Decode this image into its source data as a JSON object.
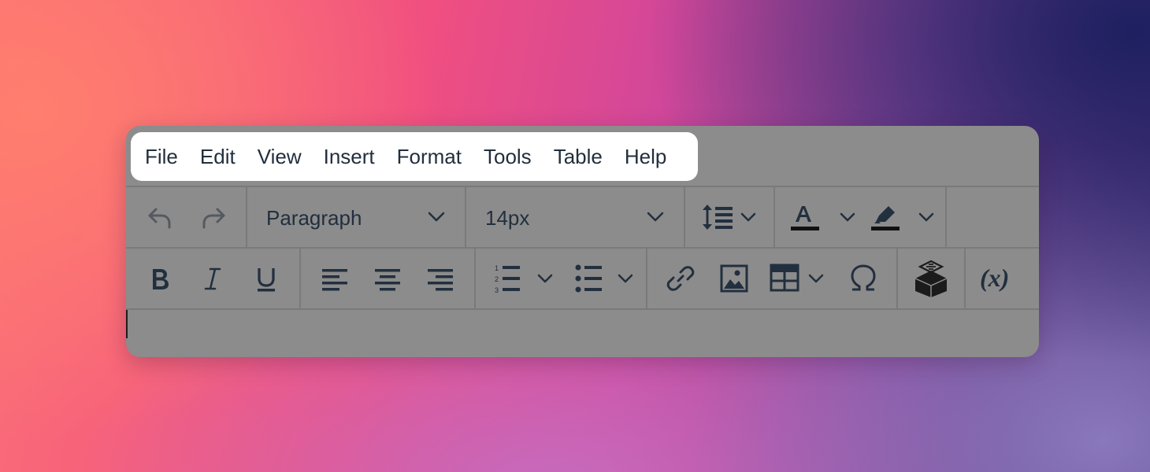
{
  "menubar": {
    "items": [
      "File",
      "Edit",
      "View",
      "Insert",
      "Format",
      "Tools",
      "Table",
      "Help"
    ]
  },
  "toolbar": {
    "block_format": "Paragraph",
    "font_size": "14px",
    "icons_row1": [
      "undo-icon",
      "redo-icon",
      "line-height-icon",
      "text-color-icon",
      "highlight-color-icon"
    ],
    "icons_row2": [
      "bold-icon",
      "italic-icon",
      "underline-icon",
      "align-left-icon",
      "align-center-icon",
      "align-right-icon",
      "numbered-list-icon",
      "bullet-list-icon",
      "link-icon",
      "image-icon",
      "table-icon",
      "special-character-icon",
      "code-sample-icon",
      "merge-tags-icon"
    ]
  },
  "colors": {
    "editor_background": "#8c8c8c",
    "icon_color": "#222f3e",
    "disabled_icon_color": "#555a60"
  }
}
